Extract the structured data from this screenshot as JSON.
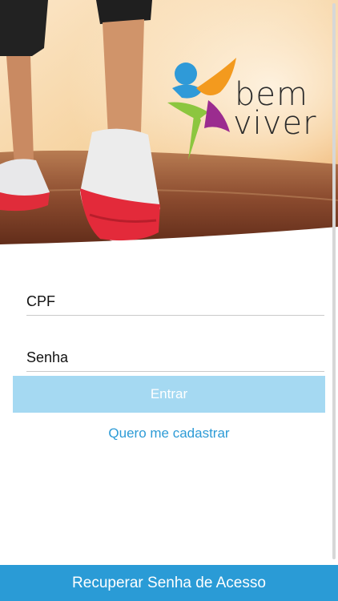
{
  "brand": {
    "line1": "bem",
    "line2": "viver"
  },
  "login": {
    "cpf_placeholder": "CPF",
    "senha_placeholder": "Senha",
    "enter_label": "Entrar",
    "register_link": "Quero me cadastrar"
  },
  "footer": {
    "recover_label": "Recuperar Senha de Acesso"
  },
  "colors": {
    "accent": "#2a9bd6",
    "button_disabled": "#a5d9f2",
    "logo_blue": "#2f9ad8",
    "logo_orange": "#f39a1e",
    "logo_green": "#8cc63f",
    "logo_purple": "#9b2c8f"
  }
}
